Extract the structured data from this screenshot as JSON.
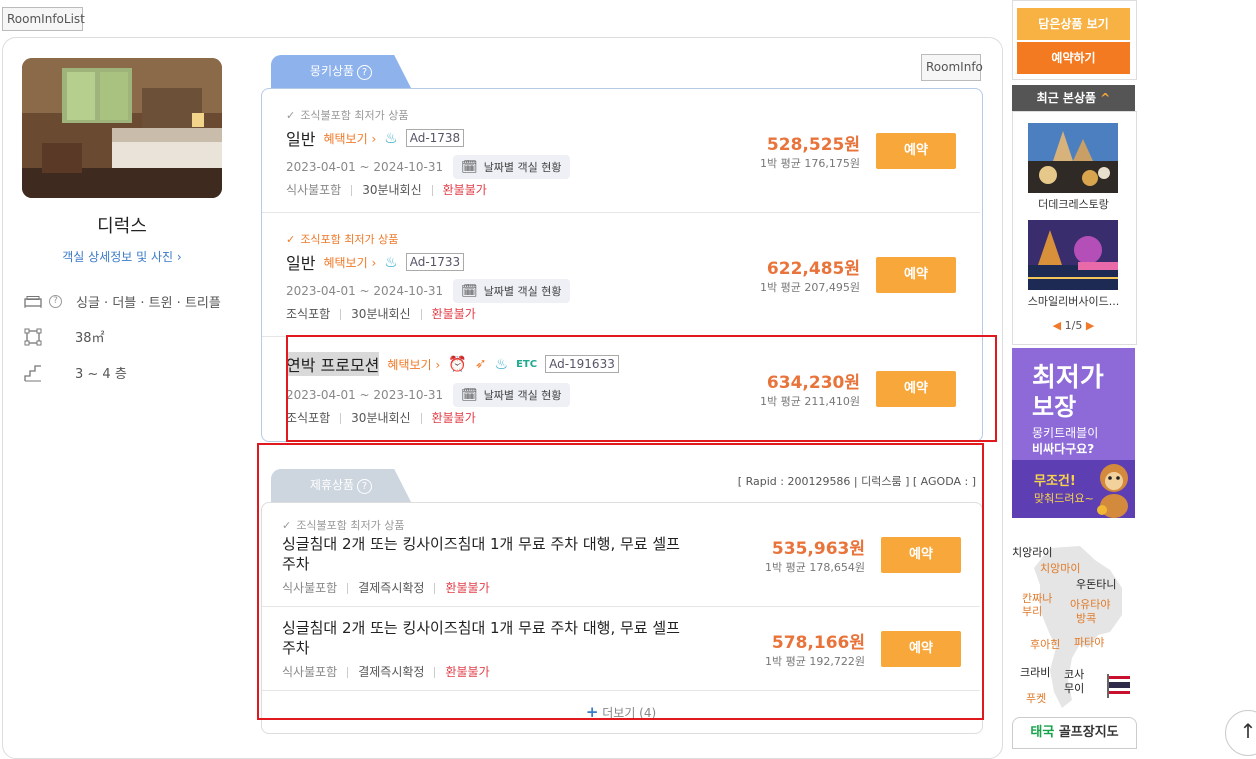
{
  "top": {
    "room_info_list": "RoomInfoList",
    "room_info": "RoomInfo"
  },
  "room": {
    "name": "디럭스",
    "detail_link": "객실 상세정보 및 사진",
    "bed": "싱글 · 더블 · 트윈 · 트리플",
    "size": "38㎡",
    "floors": "3 ~ 4 층"
  },
  "monkey": {
    "tab_label": "몽키상품",
    "offers": [
      {
        "note": "조식불포함 최저가 상품",
        "title": "일반",
        "benefit": "혜택보기",
        "ad": "Ad-1738",
        "period": "2023-04-01 ~ 2024-10-31",
        "avail": "날짜별 객실 현황",
        "meal": "식사불포함",
        "reply": "30분내회신",
        "refund": "환불불가",
        "price": "528,525원",
        "avg": "1박 평균 176,175원",
        "reserve": "예약"
      },
      {
        "note": "조식포함 최저가 상품",
        "title": "일반",
        "benefit": "혜택보기",
        "ad": "Ad-1733",
        "period": "2023-04-01 ~ 2024-10-31",
        "avail": "날짜별 객실 현황",
        "meal": "조식포함",
        "reply": "30분내회신",
        "refund": "환불불가",
        "price": "622,485원",
        "avg": "1박 평균 207,495원",
        "reserve": "예약"
      },
      {
        "title": "연박 프로모션",
        "benefit": "혜택보기",
        "etc": "ETC",
        "ad": "Ad-191633",
        "period": "2023-04-01 ~ 2023-10-31",
        "avail": "날짜별 객실 현황",
        "meal": "조식포함",
        "reply": "30분내회신",
        "refund": "환불불가",
        "price": "634,230원",
        "avg": "1박 평균 211,410원",
        "reserve": "예약"
      }
    ]
  },
  "partner": {
    "tab_label": "제휴상품",
    "info": "[ Rapid : 200129586 | 디럭스룸 ] [ AGODA : ]",
    "offers": [
      {
        "note": "조식불포함 최저가 상품",
        "title": "싱글침대 2개 또는 킹사이즈침대 1개 무료 주차 대행, 무료 셀프 주차",
        "meal": "식사불포함",
        "pay": "결제즉시확정",
        "refund": "환불불가",
        "price": "535,963원",
        "avg": "1박 평균 178,654원",
        "reserve": "예약"
      },
      {
        "title": "싱글침대 2개 또는 킹사이즈침대 1개 무료 주차 대행, 무료 셀프 주차",
        "meal": "식사불포함",
        "pay": "결제즉시확정",
        "refund": "환불불가",
        "price": "578,166원",
        "avg": "1박 평균 192,722원",
        "reserve": "예약"
      }
    ],
    "more": "더보기 (4)"
  },
  "sidebar": {
    "saved_btn": "담은상품 보기",
    "book_btn": "예약하기",
    "recent_title": "최근 본상품",
    "recent": [
      "더데크레스토랑",
      "스마일리버사이드..."
    ],
    "pager": "1/5",
    "banner": {
      "line1": "최저가",
      "line2": "보장",
      "line3": "몽키트래블이",
      "line4": "비싸다구요?",
      "line5": "무조건!",
      "line6": "맞춰드려요~"
    },
    "map_labels": [
      "치앙라이",
      "치앙마이",
      "우돈타니",
      "칸짜나",
      "부리",
      "아유타야",
      "방콕",
      "후아힌",
      "파타야",
      "크라비",
      "코사",
      "무이",
      "푸켓"
    ],
    "golf": {
      "prefix": "태국",
      "rest": " 골프장지도"
    }
  },
  "colors": {
    "accent": "#f8a83a",
    "tab_blue": "#8eb3ec",
    "highlight_red": "#e0191e"
  }
}
